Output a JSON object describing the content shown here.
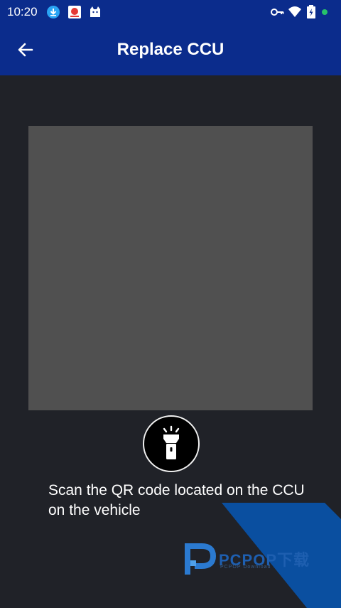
{
  "status_bar": {
    "time": "10:20",
    "left_icons": [
      "download-icon",
      "app-notification-icon",
      "cat-app-icon"
    ],
    "right_icons": [
      "vpn-key-icon",
      "wifi-icon",
      "battery-icon",
      "green-dot-icon"
    ]
  },
  "header": {
    "title": "Replace CCU",
    "back_icon": "arrow-left-icon"
  },
  "scanner": {
    "flashlight_icon": "flashlight-icon"
  },
  "instruction": "Scan the QR code located on the CCU on the vehicle",
  "watermark": {
    "brand": "PCPOP下载",
    "sub": "PCPOP Download"
  },
  "colors": {
    "header_bg": "#0b2c8c",
    "page_bg": "#202228",
    "scanner_bg": "#505050",
    "corner_accent": "#0a4fa0"
  }
}
